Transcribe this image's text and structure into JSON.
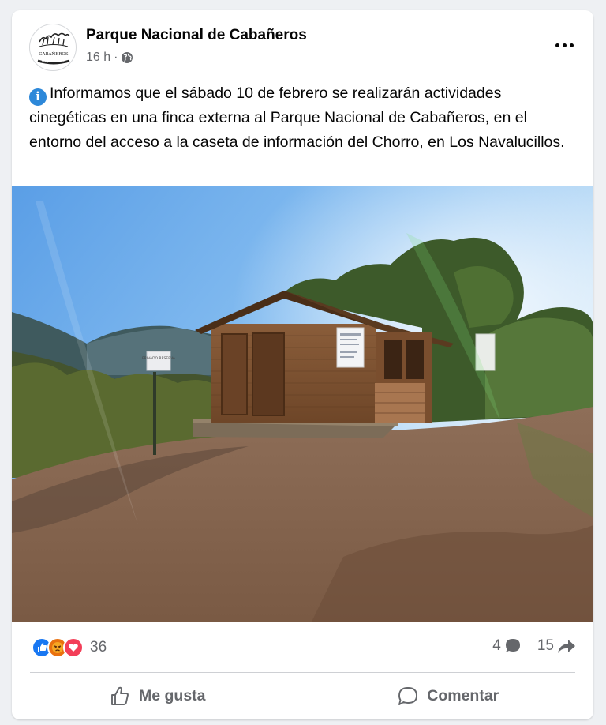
{
  "post": {
    "page_name": "Parque Nacional de Cabañeros",
    "time": "16 h",
    "separator": "·",
    "privacy_icon": "globe-icon",
    "more_icon": "more-options-icon",
    "info_icon": "information-icon",
    "info_icon_glyph": "i",
    "text": "Informamos que el sábado 10 de febrero se realizarán actividades cinegéticas en una finca externa al Parque Nacional de Cabañeros, en el entorno del acceso a la caseta de información del Chorro, en Los Navalucillos.",
    "avatar": {
      "logo_text": "CABAÑEROS",
      "logo_subtext": "PARQUE NACIONAL"
    }
  },
  "photo": {
    "sign_text": "PRIVADO RESERVA"
  },
  "stats": {
    "reactions": [
      "like",
      "angry",
      "love"
    ],
    "reaction_count": "36",
    "comment_count": "4",
    "share_count": "15"
  },
  "actions": {
    "like_label": "Me gusta",
    "comment_label": "Comentar"
  },
  "colors": {
    "brand_blue": "#1877f2",
    "secondary_text": "#65676b",
    "love": "#f33e58",
    "angry": "#e9710f"
  }
}
